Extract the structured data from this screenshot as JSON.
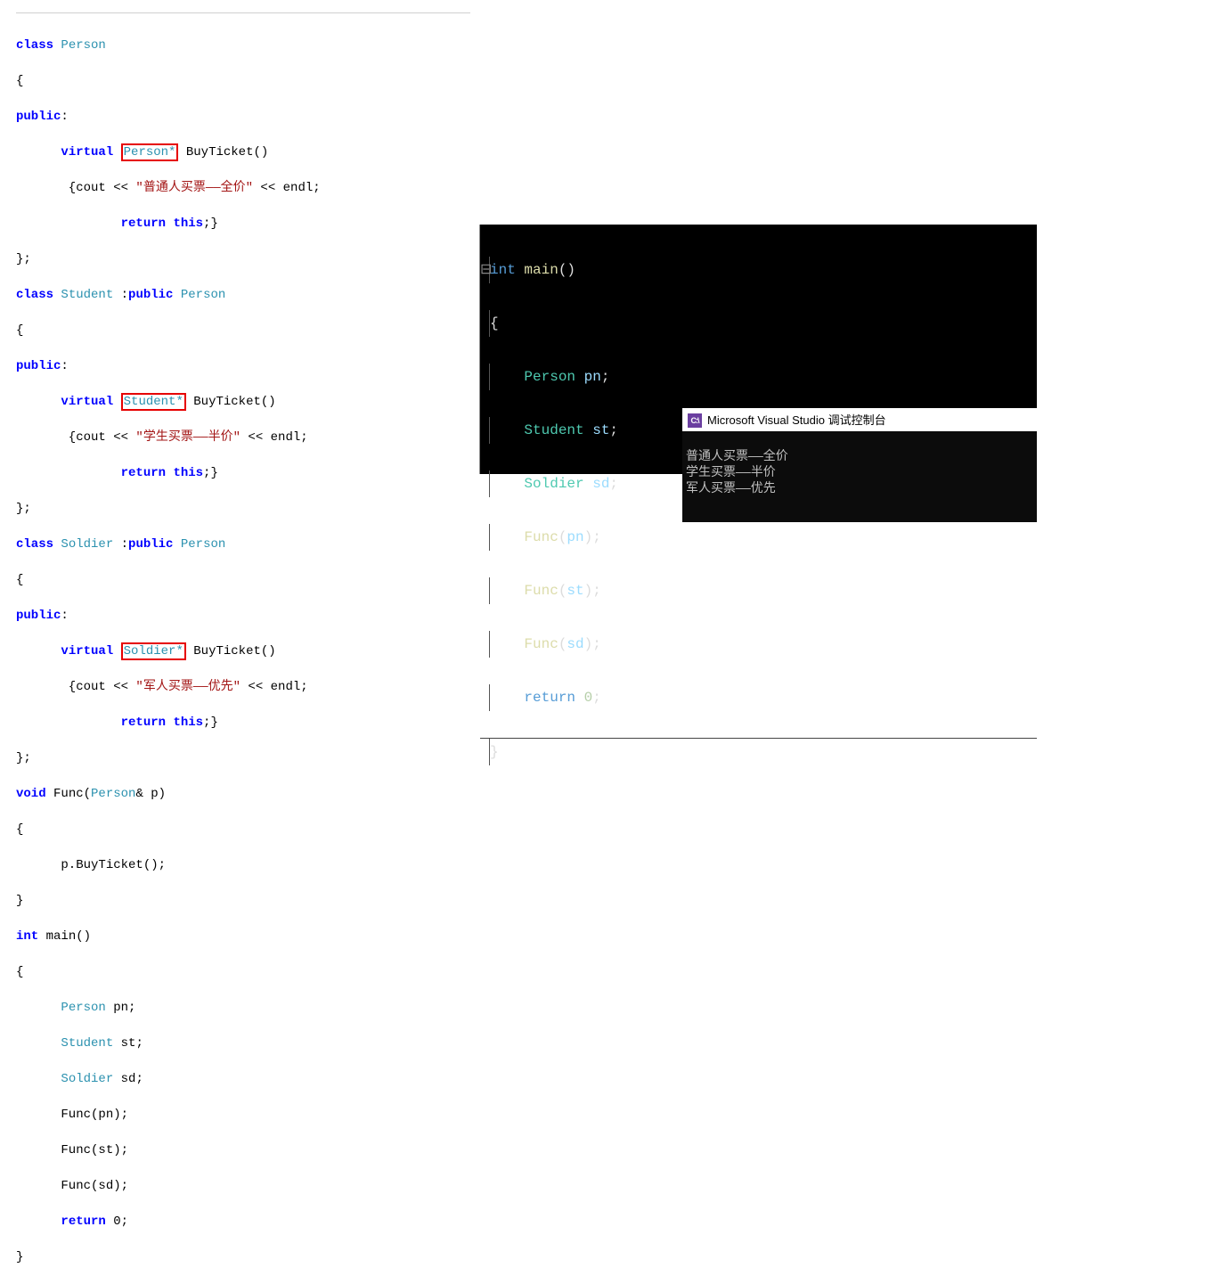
{
  "left_code": {
    "l1": {
      "kw": "class",
      "sp": " ",
      "type": "Person"
    },
    "l2": "{",
    "l3": {
      "kw": "public",
      "tail": ":"
    },
    "l4": {
      "indent": "      ",
      "kw": "virtual",
      "g": " ",
      "box": "Person*",
      "g2": " ",
      "fn": "BuyTicket()"
    },
    "l5": {
      "indent": "       {cout << ",
      "str": "\"普通人买票——全价\"",
      "tail": " << endl;"
    },
    "l6": {
      "indent": "              ",
      "kw": "return ",
      "kw2": "this",
      "tail": ";}"
    },
    "l7": "};",
    "l8": {
      "kw": "class",
      "sp": " ",
      "type": "Student",
      "mid": " :",
      "kw2": "public",
      "sp2": " ",
      "type2": "Person"
    },
    "l9": "{",
    "l10": {
      "kw": "public",
      "tail": ":"
    },
    "l11": {
      "indent": "      ",
      "kw": "virtual",
      "g": " ",
      "box": "Student*",
      "g2": " ",
      "fn": "BuyTicket()"
    },
    "l12": {
      "indent": "       {cout << ",
      "str": "\"学生买票——半价\"",
      "tail": " << endl;"
    },
    "l13": {
      "indent": "              ",
      "kw": "return ",
      "kw2": "this",
      "tail": ";}"
    },
    "l14": "};",
    "l15": {
      "kw": "class",
      "sp": " ",
      "type": "Soldier",
      "mid": " :",
      "kw2": "public",
      "sp2": " ",
      "type2": "Person"
    },
    "l16": "{",
    "l17": {
      "kw": "public",
      "tail": ":"
    },
    "l18": {
      "indent": "      ",
      "kw": "virtual",
      "g": " ",
      "box": "Soldier*",
      "g2": " ",
      "fn": "BuyTicket()"
    },
    "l19": {
      "indent": "       {cout << ",
      "str": "\"军人买票——优先\"",
      "tail": " << endl;"
    },
    "l20": {
      "indent": "              ",
      "kw": "return ",
      "kw2": "this",
      "tail": ";}"
    },
    "l21": "};",
    "l22": {
      "kw": "void",
      "sp": " ",
      "fn": "Func(",
      "type": "Person",
      "tail": "& p)"
    },
    "l23": "{",
    "l24": "      p.BuyTicket();",
    "l25": "}",
    "l26": {
      "kw": "int",
      "tail": " main()"
    },
    "l27": "{",
    "l28": {
      "indent": "      ",
      "type": "Person",
      "tail": " pn;"
    },
    "l29": {
      "indent": "      ",
      "type": "Student",
      "tail": " st;"
    },
    "l30": {
      "indent": "      ",
      "type": "Soldier",
      "tail": " sd;"
    },
    "l31": "      Func(pn);",
    "l32": "      Func(st);",
    "l33": "      Func(sd);",
    "l34": {
      "indent": "      ",
      "kw": "return",
      "tail": " 0;"
    },
    "l35": "}"
  },
  "right_code": {
    "r1": {
      "kw": "int ",
      "fn": "main",
      "tail": "()"
    },
    "r2": "{",
    "r3": {
      "indent": "    ",
      "type": "Person ",
      "var": "pn",
      "tail": ";"
    },
    "r4": {
      "indent": "    ",
      "type": "Student ",
      "var": "st",
      "tail": ";"
    },
    "r5": {
      "indent": "    ",
      "type": "Soldier ",
      "var": "sd",
      "tail": ";"
    },
    "r6": {
      "indent": "    ",
      "fn": "Func",
      "p": "(",
      "var": "pn",
      "tail": ");"
    },
    "r7": {
      "indent": "    ",
      "fn": "Func",
      "p": "(",
      "var": "st",
      "tail": ");"
    },
    "r8": {
      "indent": "    ",
      "fn": "Func",
      "p": "(",
      "var": "sd",
      "tail": ");"
    },
    "r9": {
      "indent": "    ",
      "kw": "return ",
      "num": "0",
      "tail": ";"
    },
    "r10": "}"
  },
  "console": {
    "icon_text": "C:\\",
    "title": "Microsoft Visual Studio 调试控制台",
    "line1": "普通人买票——全价",
    "line2": "学生买票——半价",
    "line3": "军人买票——优先"
  }
}
